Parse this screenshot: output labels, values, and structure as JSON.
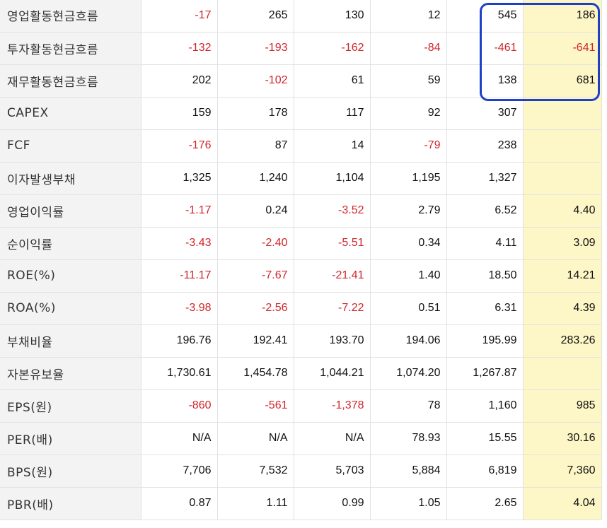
{
  "table": {
    "rows": [
      {
        "label": "영업활동현금흐름",
        "values": [
          "-17",
          "265",
          "130",
          "12",
          "545",
          "186"
        ]
      },
      {
        "label": "투자활동현금흐름",
        "values": [
          "-132",
          "-193",
          "-162",
          "-84",
          "-461",
          "-641"
        ]
      },
      {
        "label": "재무활동현금흐름",
        "values": [
          "202",
          "-102",
          "61",
          "59",
          "138",
          "681"
        ]
      },
      {
        "label": "CAPEX",
        "values": [
          "159",
          "178",
          "117",
          "92",
          "307",
          ""
        ]
      },
      {
        "label": "FCF",
        "values": [
          "-176",
          "87",
          "14",
          "-79",
          "238",
          ""
        ]
      },
      {
        "label": "이자발생부채",
        "values": [
          "1,325",
          "1,240",
          "1,104",
          "1,195",
          "1,327",
          ""
        ]
      },
      {
        "label": "영업이익률",
        "values": [
          "-1.17",
          "0.24",
          "-3.52",
          "2.79",
          "6.52",
          "4.40"
        ]
      },
      {
        "label": "순이익률",
        "values": [
          "-3.43",
          "-2.40",
          "-5.51",
          "0.34",
          "4.11",
          "3.09"
        ]
      },
      {
        "label": "ROE(%)",
        "values": [
          "-11.17",
          "-7.67",
          "-21.41",
          "1.40",
          "18.50",
          "14.21"
        ]
      },
      {
        "label": "ROA(%)",
        "values": [
          "-3.98",
          "-2.56",
          "-7.22",
          "0.51",
          "6.31",
          "4.39"
        ]
      },
      {
        "label": "부채비율",
        "values": [
          "196.76",
          "192.41",
          "193.70",
          "194.06",
          "195.99",
          "283.26"
        ]
      },
      {
        "label": "자본유보율",
        "values": [
          "1,730.61",
          "1,454.78",
          "1,044.21",
          "1,074.20",
          "1,267.87",
          ""
        ]
      },
      {
        "label": "EPS(원)",
        "values": [
          "-860",
          "-561",
          "-1,378",
          "78",
          "1,160",
          "985"
        ]
      },
      {
        "label": "PER(배)",
        "values": [
          "N/A",
          "N/A",
          "N/A",
          "78.93",
          "15.55",
          "30.16"
        ]
      },
      {
        "label": "BPS(원)",
        "values": [
          "7,706",
          "7,532",
          "5,703",
          "5,884",
          "6,819",
          "7,360"
        ]
      },
      {
        "label": "PBR(배)",
        "values": [
          "0.87",
          "1.11",
          "0.99",
          "1.05",
          "2.65",
          "4.04"
        ]
      }
    ]
  },
  "colors": {
    "negative": "#d0262b",
    "highlight_column": "#fdf6c6",
    "label_bg": "#f3f3f3",
    "annotation": "#1f3fc7"
  }
}
